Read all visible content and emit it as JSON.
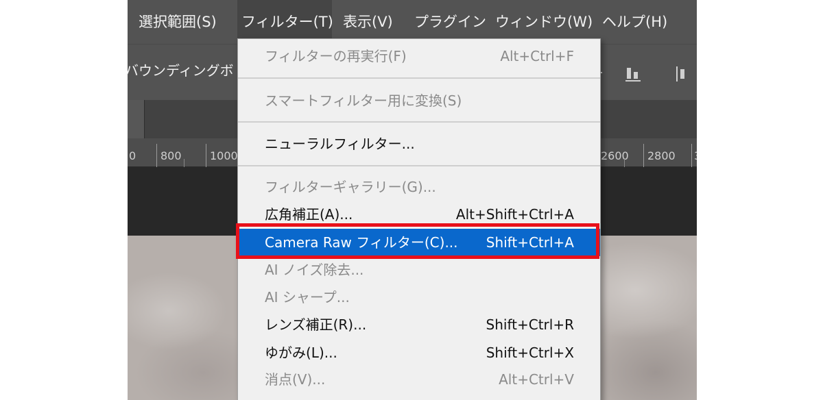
{
  "menubar": {
    "items": [
      {
        "label": "選択範囲(S)"
      },
      {
        "label": "フィルター(T)"
      },
      {
        "label": "表示(V)"
      },
      {
        "label": "プラグイン"
      },
      {
        "label": "ウィンドウ(W)"
      },
      {
        "label": "ヘルプ(H)"
      }
    ]
  },
  "optionsbar": {
    "bounding_box_text": "バウンディングボ"
  },
  "ruler": {
    "labels": [
      "0",
      "800",
      "1000",
      "2600",
      "2800",
      "3"
    ]
  },
  "filter_menu": {
    "items": [
      {
        "label": "フィルターの再実行(F)",
        "shortcut": "Alt+Ctrl+F",
        "state": "disabled"
      },
      {
        "label": "スマートフィルター用に変換(S)",
        "shortcut": "",
        "state": "disabled"
      },
      {
        "label": "ニューラルフィルター...",
        "shortcut": "",
        "state": "enabled"
      },
      {
        "label": "フィルターギャラリー(G)...",
        "shortcut": "",
        "state": "disabled"
      },
      {
        "label": "広角補正(A)...",
        "shortcut": "Alt+Shift+Ctrl+A",
        "state": "enabled"
      },
      {
        "label": "Camera Raw フィルター(C)...",
        "shortcut": "Shift+Ctrl+A",
        "state": "highlighted"
      },
      {
        "label": "AI ノイズ除去...",
        "shortcut": "",
        "state": "disabled"
      },
      {
        "label": "AI シャープ...",
        "shortcut": "",
        "state": "disabled"
      },
      {
        "label": "レンズ補正(R)...",
        "shortcut": "Shift+Ctrl+R",
        "state": "enabled"
      },
      {
        "label": "ゆがみ(L)...",
        "shortcut": "Shift+Ctrl+X",
        "state": "enabled"
      },
      {
        "label": "消点(V)...",
        "shortcut": "Alt+Ctrl+V",
        "state": "disabled"
      }
    ]
  },
  "colors": {
    "menu_highlight": "#0a68cc",
    "callout_frame": "#e8101a",
    "menubar_bg": "#535353",
    "menu_bg": "#f0f0f0"
  }
}
